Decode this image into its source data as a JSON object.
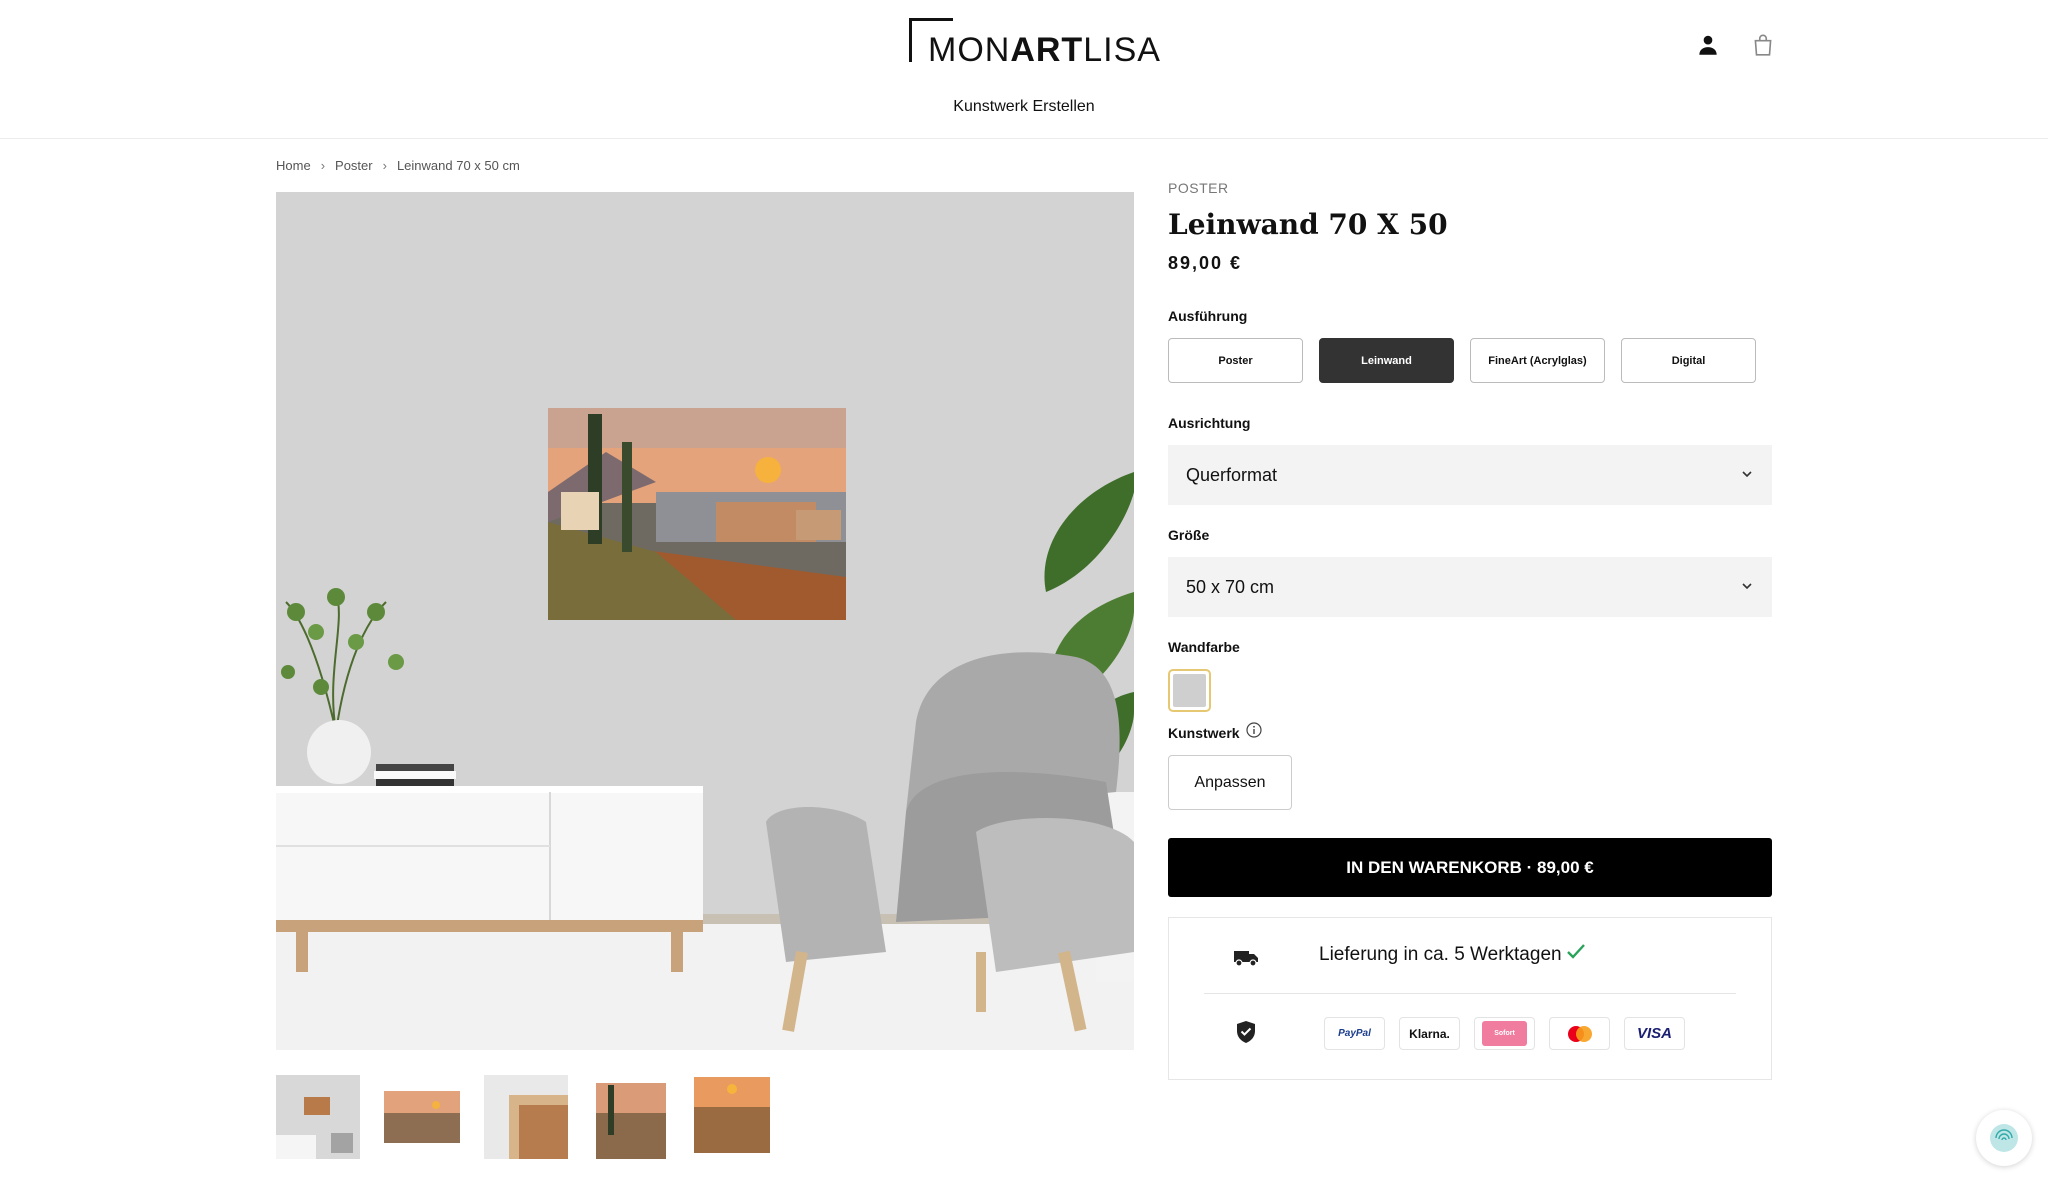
{
  "header": {
    "logo_light_1": "MON",
    "logo_bold": "ART",
    "logo_light_2": "LISA",
    "nav_link": "Kunstwerk Erstellen",
    "icons": [
      "user-icon",
      "bag-icon"
    ]
  },
  "breadcrumb": {
    "items": [
      "Home",
      "Poster",
      "Leinwand 70 x 50 cm"
    ]
  },
  "product": {
    "category": "POSTER",
    "title": "Leinwand 70 X 50",
    "price": "89,00 €",
    "ausfuehrung_label": "Ausführung",
    "ausfuehrung_options": [
      "Poster",
      "Leinwand",
      "FineArt (Acrylglas)",
      "Digital"
    ],
    "ausfuehrung_selected": "Leinwand",
    "ausrichtung_label": "Ausrichtung",
    "ausrichtung_value": "Querformat",
    "groesse_label": "Größe",
    "groesse_value": "50 x 70 cm",
    "wandfarbe_label": "Wandfarbe",
    "wandfarbe_color": "#cfcfcf",
    "kunstwerk_label": "Kunstwerk",
    "anpassen_label": "Anpassen",
    "cart_button": "IN DEN WARENKORB · 89,00 €",
    "delivery_text": "Lieferung in ca. 5 Werktagen",
    "payment_methods": [
      "PayPal",
      "Klarna.",
      "Sofort",
      "Mastercard",
      "VISA"
    ]
  },
  "colors": {
    "accent_dark": "#333333",
    "cart_bg": "#000000",
    "check_green": "#2aa35a",
    "wall_gray": "#d3d3d3"
  }
}
